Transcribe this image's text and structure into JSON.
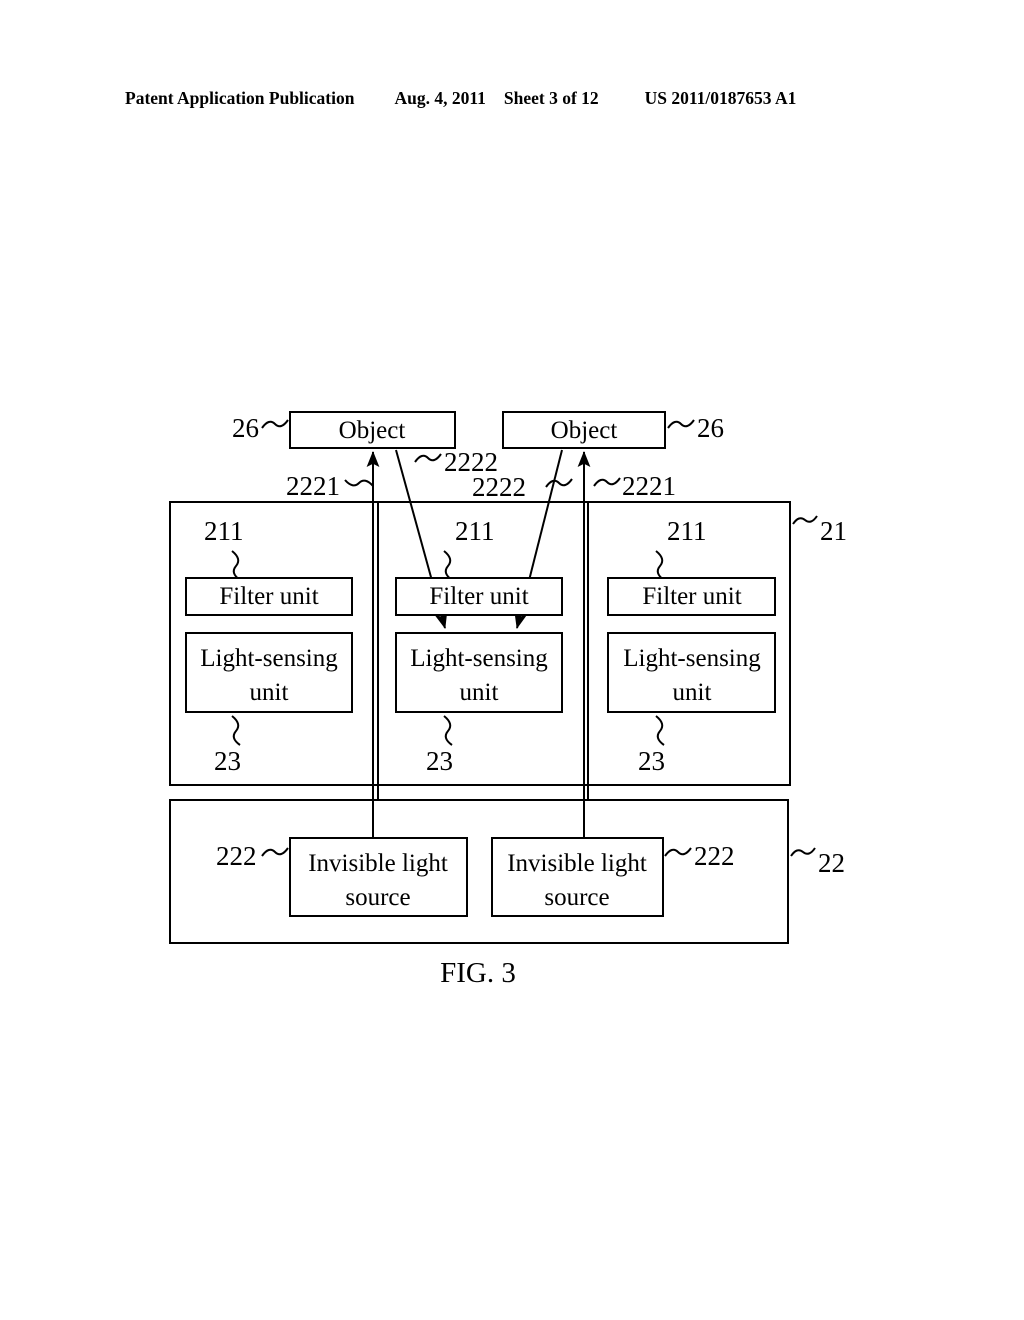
{
  "header": {
    "publication": "Patent Application Publication",
    "date": "Aug. 4, 2011",
    "sheet": "Sheet 3 of 12",
    "number": "US 2011/0187653 A1"
  },
  "figure": {
    "caption": "FIG. 3",
    "objects": [
      {
        "label": "Object",
        "ref": "26"
      },
      {
        "label": "Object",
        "ref": "26"
      }
    ],
    "panel_sensor": {
      "ref": "21",
      "columns": [
        {
          "filter": {
            "label": "Filter unit",
            "ref": "211"
          },
          "sensor": {
            "label": "Light-sensing unit",
            "ref": "23"
          }
        },
        {
          "filter": {
            "label": "Filter unit",
            "ref": "211"
          },
          "sensor": {
            "label": "Light-sensing unit",
            "ref": "23"
          }
        },
        {
          "filter": {
            "label": "Filter unit",
            "ref": "211"
          },
          "sensor": {
            "label": "Light-sensing unit",
            "ref": "23"
          }
        }
      ]
    },
    "panel_source": {
      "ref": "22",
      "sources": [
        {
          "label": "Invisible light source",
          "ref": "222"
        },
        {
          "label": "Invisible light source",
          "ref": "222"
        }
      ]
    },
    "ray_labels": {
      "emitted_left": "2221",
      "reflected_left": "2222",
      "reflected_right": "2222",
      "emitted_right": "2221"
    }
  }
}
